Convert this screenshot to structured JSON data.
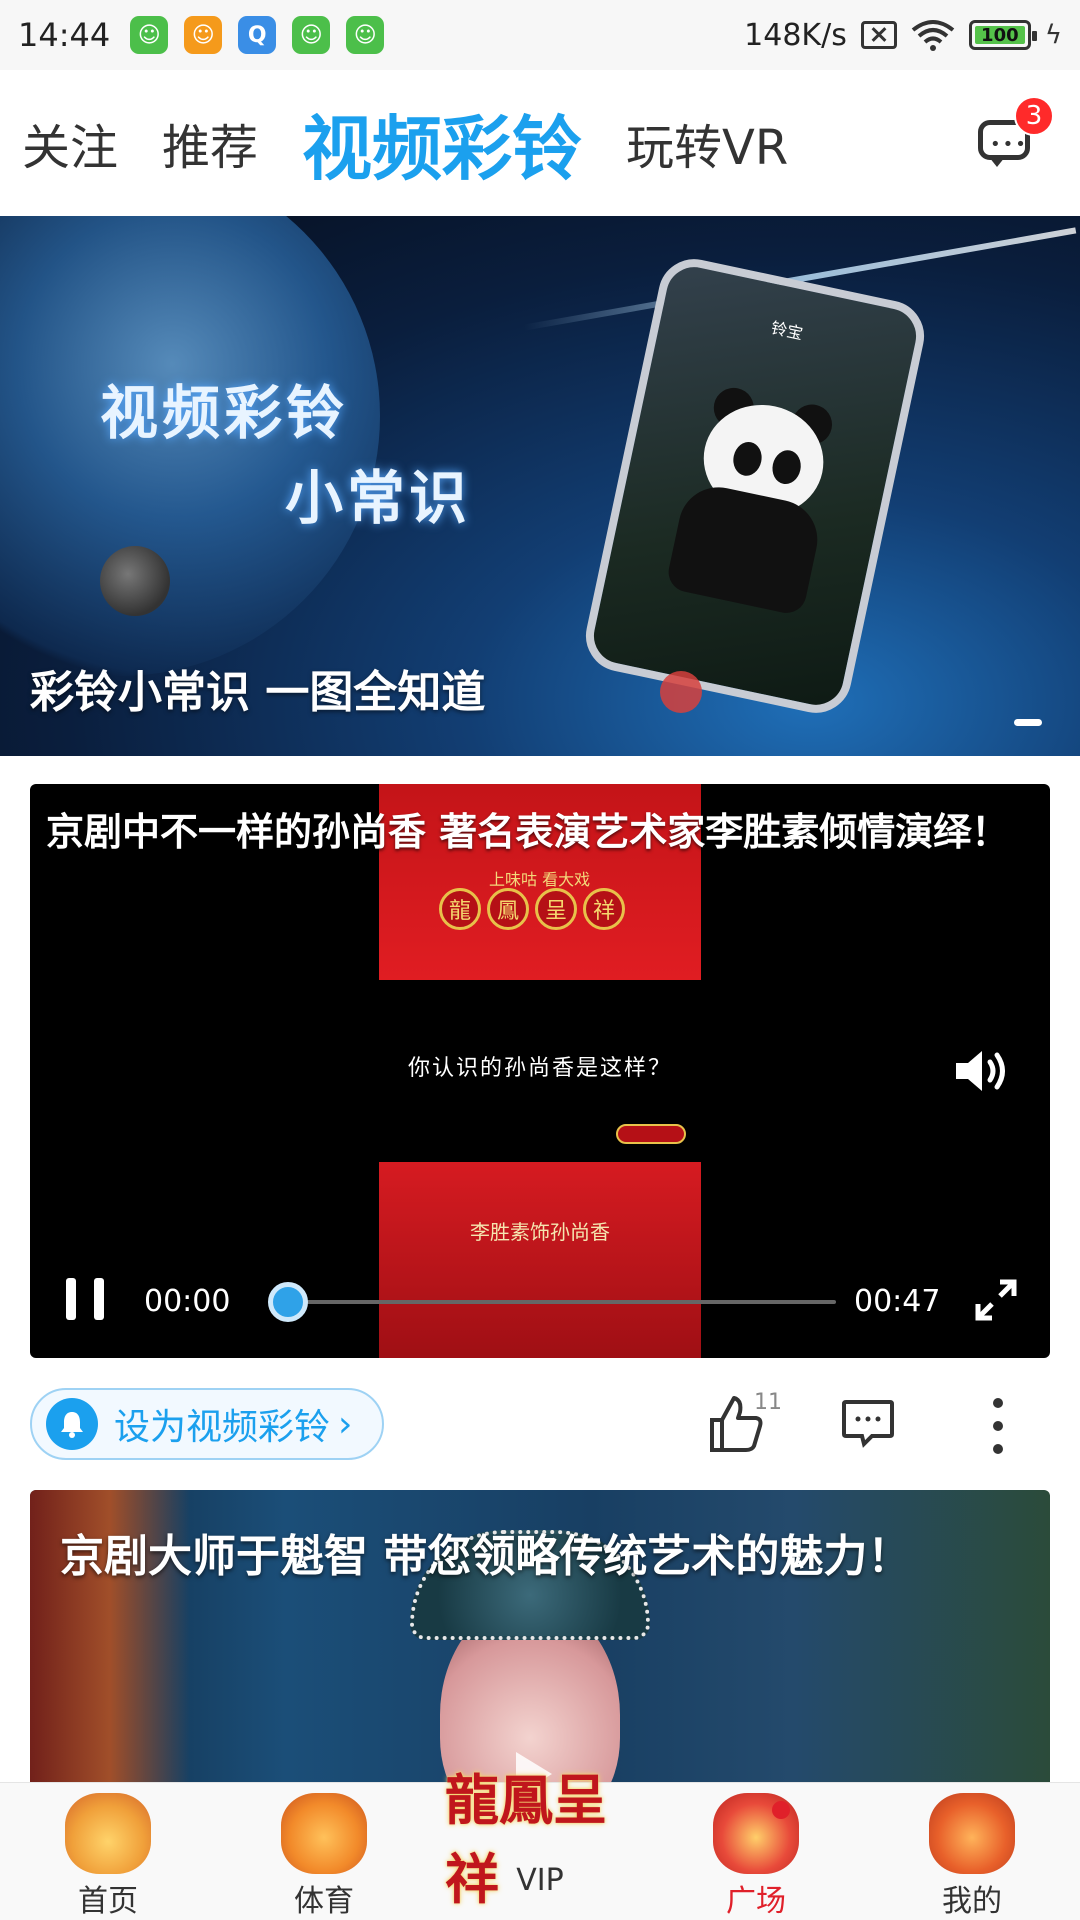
{
  "status_bar": {
    "time": "14:44",
    "net_speed": "148K/s",
    "battery": "100",
    "app_icons": [
      {
        "name": "cat-app-icon",
        "color": "#4cbf4a",
        "glyph": "☺"
      },
      {
        "name": "smile-app-icon",
        "color": "#f59a1b",
        "glyph": "☺"
      },
      {
        "name": "q-app-icon",
        "color": "#3a8ee6",
        "glyph": "Q"
      },
      {
        "name": "cat-app-icon-2",
        "color": "#4cbf4a",
        "glyph": "☺"
      },
      {
        "name": "cat-app-icon-3",
        "color": "#4cbf4a",
        "glyph": "☺"
      }
    ]
  },
  "top_nav": {
    "tabs": [
      {
        "label": "关注",
        "active": false
      },
      {
        "label": "推荐",
        "active": false
      },
      {
        "label": "视频彩铃",
        "active": true
      },
      {
        "label": "玩转VR",
        "active": false
      }
    ],
    "message_badge": "3"
  },
  "banner": {
    "title_line1": "视频彩铃",
    "title_line2": "小常识",
    "caption": "彩铃小常识 一图全知道",
    "phone_caller": "铃宝"
  },
  "video1": {
    "title": "京剧中不一样的孙尚香 著名表演艺术家李胜素倾情演绎！",
    "overlay_small": "上味咕 看大戏",
    "seal_chars": [
      "龍",
      "鳳",
      "呈",
      "祥"
    ],
    "mid_text": "你认识的孙尚香是这样？",
    "bottom_text": "李胜素饰孙尚香",
    "current_time": "00:00",
    "total_time": "00:47",
    "progress": 0.0
  },
  "actions": {
    "ringtone_label": "设为视频彩铃",
    "chevron": "›",
    "like_count": "11"
  },
  "video2": {
    "title": "京剧大师于魁智 带您领略传统艺术的魅力！"
  },
  "bottom_nav": {
    "items": [
      {
        "label": "首页",
        "active": false,
        "color": "#f0a03a"
      },
      {
        "label": "体育",
        "active": false,
        "color": "#f28a2a"
      },
      {
        "label": "VIP",
        "active": false,
        "logo": "龍鳳呈祥"
      },
      {
        "label": "广场",
        "active": true,
        "color": "#e84a3a"
      },
      {
        "label": "我的",
        "active": false,
        "color": "#e8602a"
      }
    ]
  },
  "colors": {
    "accent": "#1ba0ee",
    "active_red": "#e0202a",
    "badge_red": "#ff2a2a"
  }
}
